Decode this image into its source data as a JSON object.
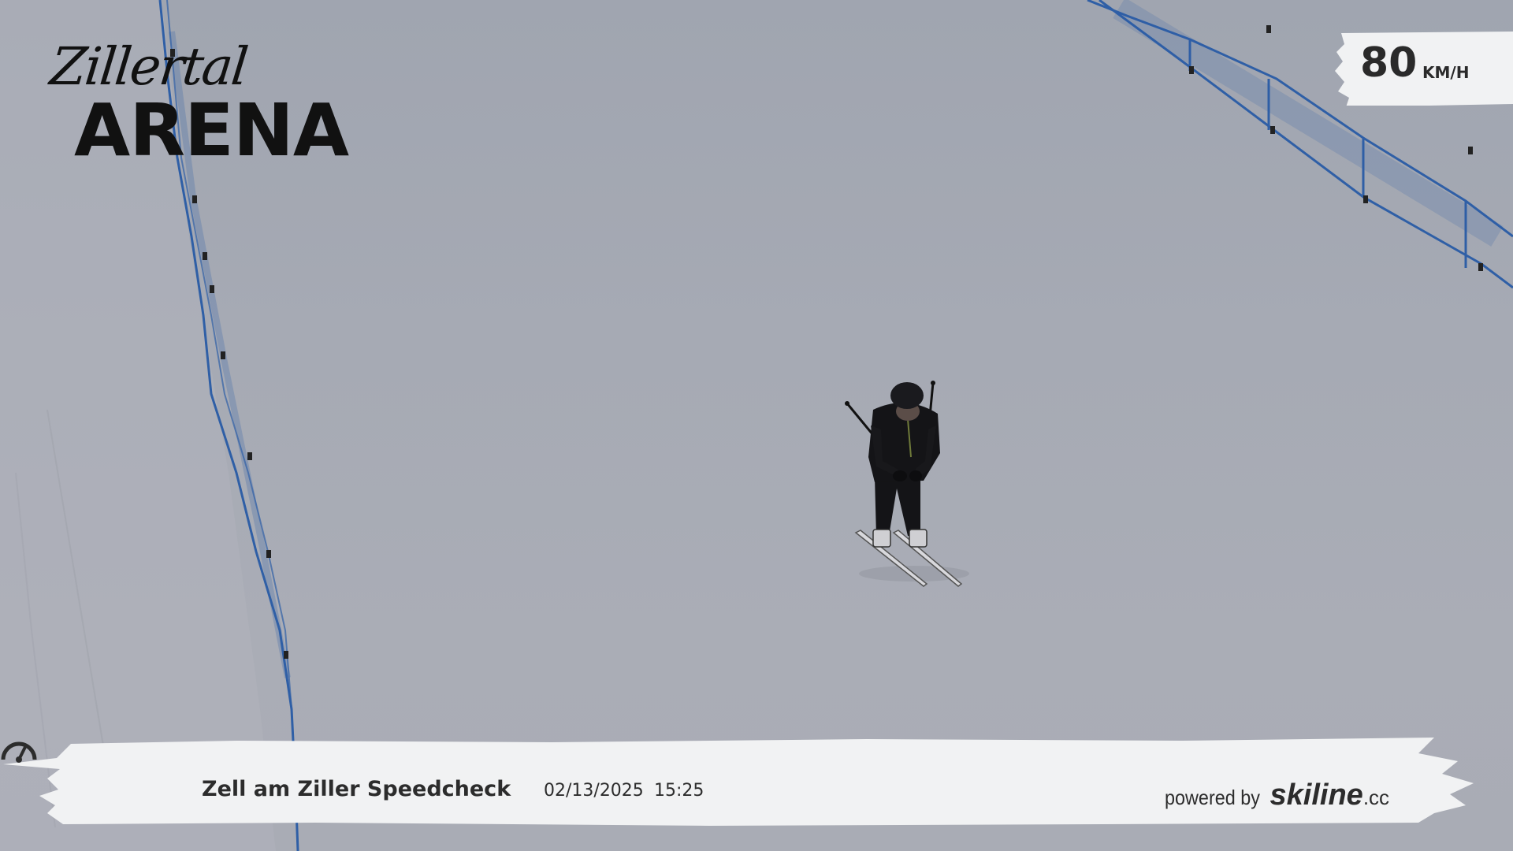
{
  "logo": {
    "line1": "Zillertal",
    "line2": "ARENA"
  },
  "speed": {
    "value": "80",
    "unit": "KM/H"
  },
  "banner": {
    "icon": "speedometer-icon",
    "title": "Zell am Ziller Speedcheck",
    "date": "02/13/2025",
    "time": "15:25",
    "powered_by": "powered by",
    "brand": "skiline",
    "brand_tld": ".cc"
  },
  "colors": {
    "snow": "#a6aab4",
    "fence": "#2f5fa6",
    "banner": "#f1f2f3",
    "text": "#2c2c2c",
    "skier": "#141417"
  }
}
